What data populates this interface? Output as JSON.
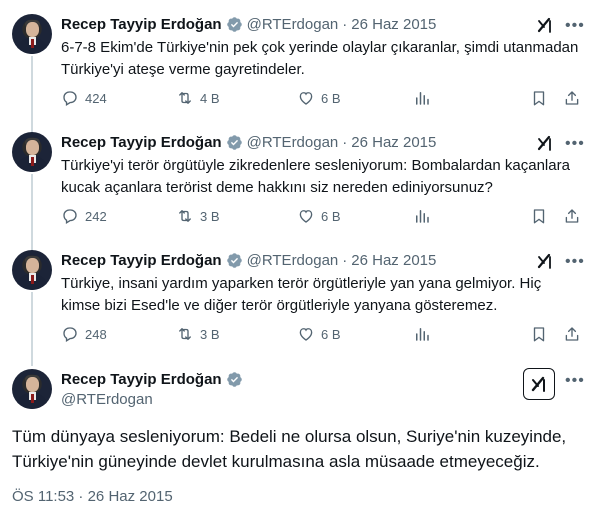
{
  "tweets": [
    {
      "name": "Recep Tayyip Erdoğan",
      "handle": "@RTErdogan",
      "separator": "·",
      "date": "26 Haz 2015",
      "text": "6-7-8 Ekim'de Türkiye'nin pek çok yerinde olaylar çıkaranlar, şimdi utanmadan Türkiye'yi ateşe verme gayretindeler.",
      "replies": "424",
      "retweets": "4 B",
      "likes": "6 B"
    },
    {
      "name": "Recep Tayyip Erdoğan",
      "handle": "@RTErdogan",
      "separator": "·",
      "date": "26 Haz 2015",
      "text": "Türkiye'yi terör örgütüyle zikredenlere sesleniyorum: Bombalardan kaçanlara kucak açanlara terörist deme hakkını siz nereden ediniyorsunuz?",
      "replies": "242",
      "retweets": "3 B",
      "likes": "6 B"
    },
    {
      "name": "Recep Tayyip Erdoğan",
      "handle": "@RTErdogan",
      "separator": "·",
      "date": "26 Haz 2015",
      "text": "Türkiye, insani yardım yaparken terör örgütleriyle yan yana gelmiyor. Hiç kimse bizi Esed'le ve diğer terör örgütleriyle yanyana gösteremez.",
      "replies": "248",
      "retweets": "3 B",
      "likes": "6 B"
    }
  ],
  "main_tweet": {
    "name": "Recep Tayyip Erdoğan",
    "handle": "@RTErdogan",
    "text": "Tüm dünyaya sesleniyorum: Bedeli ne olursa olsun, Suriye'nin kuzeyinde, Türkiye'nin güneyinde devlet kurulmasına asla müsaade etmeyeceğiz.",
    "timestamp": "ÖS 11:53 · 26 Haz 2015"
  },
  "icons": {
    "verified": "verified-badge-icon",
    "grok": "grok-icon",
    "more": "more-icon",
    "reply": "reply-icon",
    "retweet": "retweet-icon",
    "like": "like-icon",
    "views": "views-icon",
    "bookmark": "bookmark-icon",
    "share": "share-icon"
  },
  "colors": {
    "text": "#0f1419",
    "secondary": "#536471",
    "verified": "#829aab",
    "thread_line": "#cfd9de"
  }
}
